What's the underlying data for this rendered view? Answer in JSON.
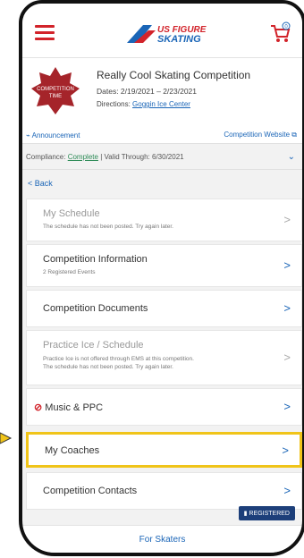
{
  "header": {
    "logo_text": "US FIGURE SKATING",
    "menu_icon": "hamburger-icon",
    "cart_icon": "cart-icon",
    "cart_count": "0"
  },
  "competition": {
    "badge_text": "COMPETITION TIME",
    "title": "Really Cool Skating Competition",
    "dates": "Dates: 2/19/2021 – 2/23/2021",
    "directions_label": "Directions:",
    "directions_link": "Goggin Ice Center",
    "announcement": "Announcement",
    "website": "Competition Website"
  },
  "compliance": {
    "label": "Compliance:",
    "status": "Complete",
    "valid": "| Valid Through: 6/30/2021"
  },
  "back_label": "Back",
  "items": [
    {
      "title": "My Schedule",
      "sub": "The schedule has not been posted. Try again later."
    },
    {
      "title": "Competition Information",
      "sub": "2 Registered Events"
    },
    {
      "title": "Competition Documents",
      "sub": ""
    },
    {
      "title": "Practice Ice / Schedule",
      "sub1": "Practice Ice is not offered through EMS at this competition.",
      "sub2": "The schedule has not been posted. Try again later."
    },
    {
      "title": "Music & PPC",
      "sub": ""
    },
    {
      "title": "My Coaches",
      "sub": ""
    },
    {
      "title": "Competition Contacts",
      "sub": ""
    }
  ],
  "registered_badge": "REGISTERED",
  "footer": "For Skaters",
  "colors": {
    "accent": "#1a65b7",
    "brand_red": "#d2232a",
    "highlight": "#f0c419",
    "badge_blue": "#1d3f7a"
  }
}
